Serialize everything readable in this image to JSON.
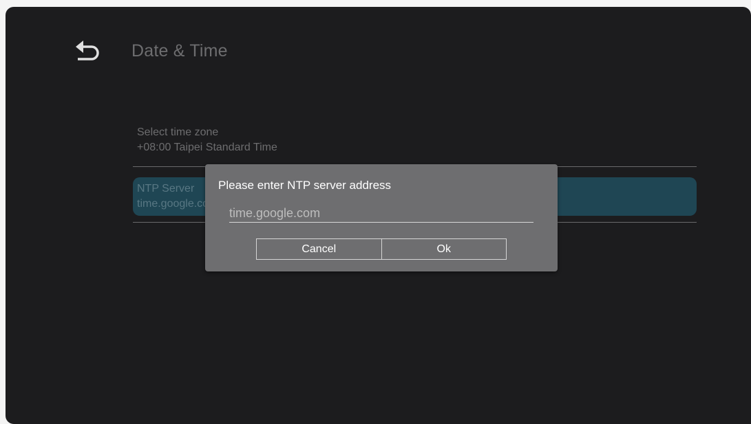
{
  "page": {
    "title": "Date & Time",
    "back_icon": "back-arrow-icon"
  },
  "settings": {
    "timezone": {
      "title": "Select time zone",
      "value": "+08:00 Taipei Standard Time"
    },
    "ntp": {
      "title": "NTP Server",
      "value": "time.google.com"
    }
  },
  "dialog": {
    "title": "Please enter NTP server address",
    "input_value": "time.google.com",
    "cancel_label": "Cancel",
    "ok_label": "Ok"
  },
  "colors": {
    "background": "#1c1c1e",
    "selected_item": "#1f4654",
    "dialog": "#6e6e70"
  }
}
